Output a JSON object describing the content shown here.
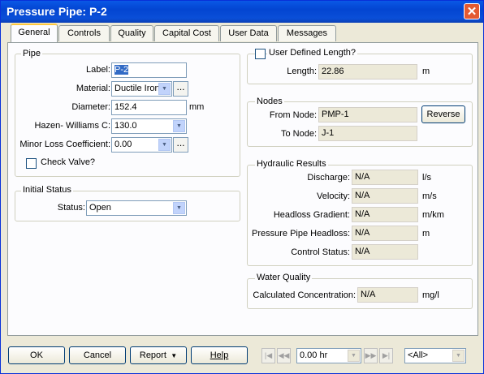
{
  "window": {
    "title": "Pressure Pipe: P-2",
    "close_glyph": "✕"
  },
  "tabs": [
    "General",
    "Controls",
    "Quality",
    "Capital Cost",
    "User Data",
    "Messages"
  ],
  "pipe": {
    "group_title": "Pipe",
    "label_label": "Label:",
    "label_value": "P-2",
    "material_label": "Material:",
    "material_value": "Ductile Iron",
    "diameter_label": "Diameter:",
    "diameter_value": "152.4",
    "diameter_unit": "mm",
    "hw_label": "Hazen- Williams C:",
    "hw_value": "130.0",
    "minor_label": "Minor Loss Coefficient:",
    "minor_value": "0.00",
    "check_valve_label": "Check Valve?"
  },
  "initial_status": {
    "group_title": "Initial Status",
    "status_label": "Status:",
    "status_value": "Open"
  },
  "length": {
    "user_defined_label": "User Defined Length?",
    "length_label": "Length:",
    "length_value": "22.86",
    "length_unit": "m"
  },
  "nodes": {
    "group_title": "Nodes",
    "from_label": "From Node:",
    "from_value": "PMP-1",
    "to_label": "To Node:",
    "to_value": "J-1",
    "reverse_label": "Reverse"
  },
  "hydraulic": {
    "group_title": "Hydraulic Results",
    "discharge_label": "Discharge:",
    "discharge_value": "N/A",
    "discharge_unit": "l/s",
    "velocity_label": "Velocity:",
    "velocity_value": "N/A",
    "velocity_unit": "m/s",
    "headloss_grad_label": "Headloss Gradient:",
    "headloss_grad_value": "N/A",
    "headloss_grad_unit": "m/km",
    "pp_headloss_label": "Pressure Pipe Headloss:",
    "pp_headloss_value": "N/A",
    "pp_headloss_unit": "m",
    "control_label": "Control Status:",
    "control_value": "N/A"
  },
  "water_quality": {
    "group_title": "Water Quality",
    "conc_label": "Calculated Concentration:",
    "conc_value": "N/A",
    "conc_unit": "mg/l"
  },
  "footer": {
    "ok": "OK",
    "cancel": "Cancel",
    "report": "Report",
    "help": "Help",
    "time_value": "0.00 hr",
    "scenario_value": "<All>"
  }
}
